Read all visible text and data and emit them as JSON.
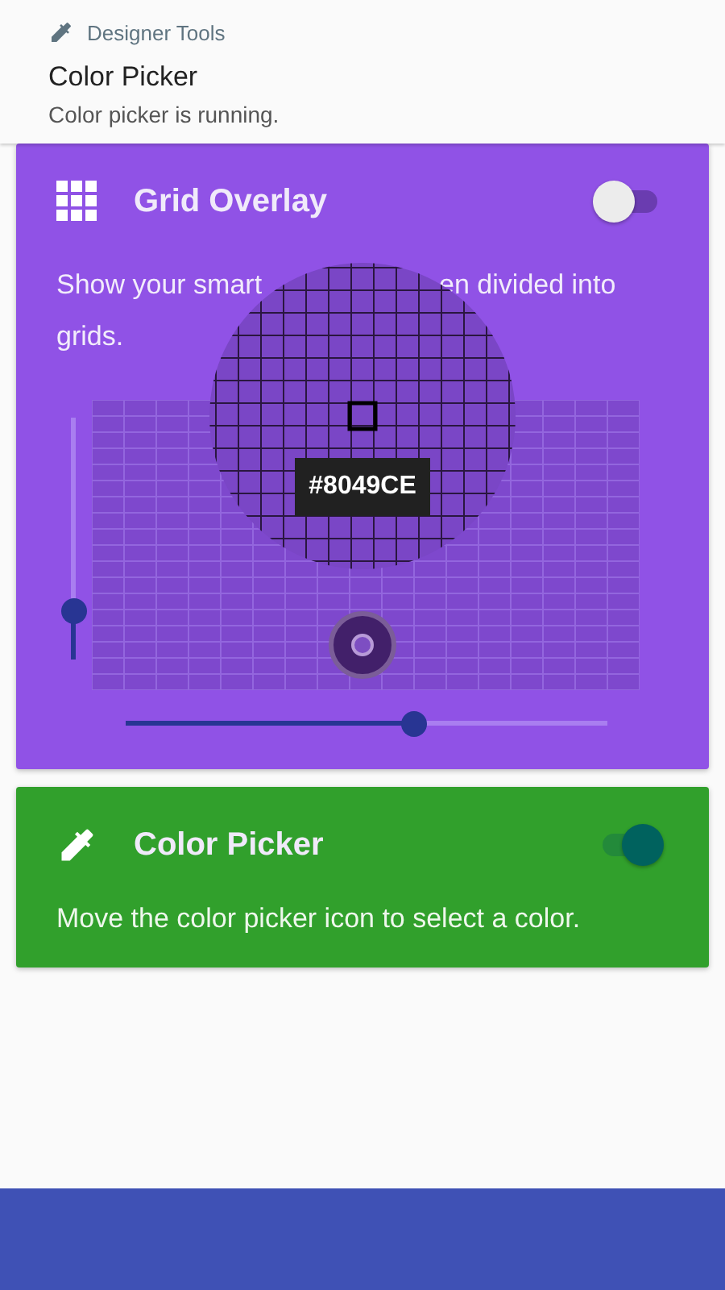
{
  "notification": {
    "app": "Designer Tools",
    "title": "Color Picker",
    "text": "Color picker is running."
  },
  "grid_card": {
    "title": "Grid Overlay",
    "on": false,
    "description_parts": [
      "Show your smart",
      "en divided into",
      "grids."
    ],
    "vertical_slider": {
      "level": 0.2
    },
    "horizontal_slider": {
      "level": 0.6
    }
  },
  "magnifier": {
    "hex": "#8049CE"
  },
  "picker_card": {
    "title": "Color Picker",
    "on": true,
    "description": "Move the color picker icon to select a color."
  }
}
